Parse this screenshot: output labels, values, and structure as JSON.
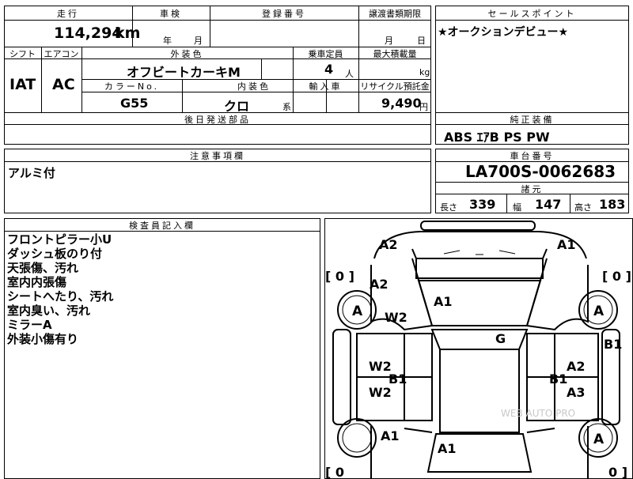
{
  "header": {
    "mileage_label": "走行",
    "inspection_label": "車検",
    "registration_label": "登録番号",
    "transfer_label": "譲渡書類期限",
    "sales_point_label": "セールスポイント"
  },
  "vehicle": {
    "mileage": "114,294",
    "mileage_unit": "km",
    "inspection_year": "年",
    "inspection_month": "月",
    "transfer_month": "月",
    "transfer_day": "日",
    "shift_label": "シフト",
    "aircon_label": "エアコン",
    "exterior_label": "外装色",
    "seats_label": "乗車定員",
    "load_label": "最大積載量",
    "shift": "IAT",
    "aircon": "AC",
    "exterior_color": "オフビートカーキM",
    "seats": "4",
    "seats_unit": "人",
    "load_unit": "kg",
    "color_no_label": "カラーNo.",
    "interior_label": "内装色",
    "import_label": "輸入車",
    "recycle_label": "リサイクル預託金",
    "color_no": "G55",
    "interior_color": "クロ",
    "interior_suffix": "系",
    "recycle_fee": "9,490",
    "recycle_unit": "円",
    "later_parts_label": "後日発送部品"
  },
  "sales_point": {
    "text": "★オークションデビュー★"
  },
  "equipment": {
    "label": "純正装備",
    "value": "ABS ｴｱB PS PW"
  },
  "caution": {
    "label": "注意事項欄",
    "text": "アルミ付"
  },
  "chassis": {
    "label": "車台番号",
    "number": "LA700S-0062683",
    "specs_label": "諸元",
    "length_label": "長さ",
    "length": "339",
    "width_label": "幅",
    "width": "147",
    "height_label": "高さ",
    "height": "183"
  },
  "inspector": {
    "label": "検査員記入欄",
    "notes": [
      "フロントピラー小U",
      "ダッシュ板のり付",
      "天張傷、汚れ",
      "室内内張傷",
      "シートへたり、汚れ",
      "室内臭い、汚れ",
      "ミラーA",
      "外装小傷有り"
    ]
  },
  "diagram": {
    "watermark": "WEB AUTO PRO",
    "tire_left": "[ 0 ]",
    "tire_right": "[ 0 ]",
    "tire_bottom_left": "[ 0",
    "tire_bottom_right": "0 ]",
    "marks": [
      "A2",
      "A1",
      "A2",
      "A",
      "W2",
      "A1",
      "A",
      "G",
      "B1",
      "W2",
      "B1",
      "W2",
      "B1",
      "A2",
      "A3",
      "A1",
      "A1",
      "A"
    ],
    "wheel_mark_left": "A",
    "wheel_mark_right": "A"
  }
}
